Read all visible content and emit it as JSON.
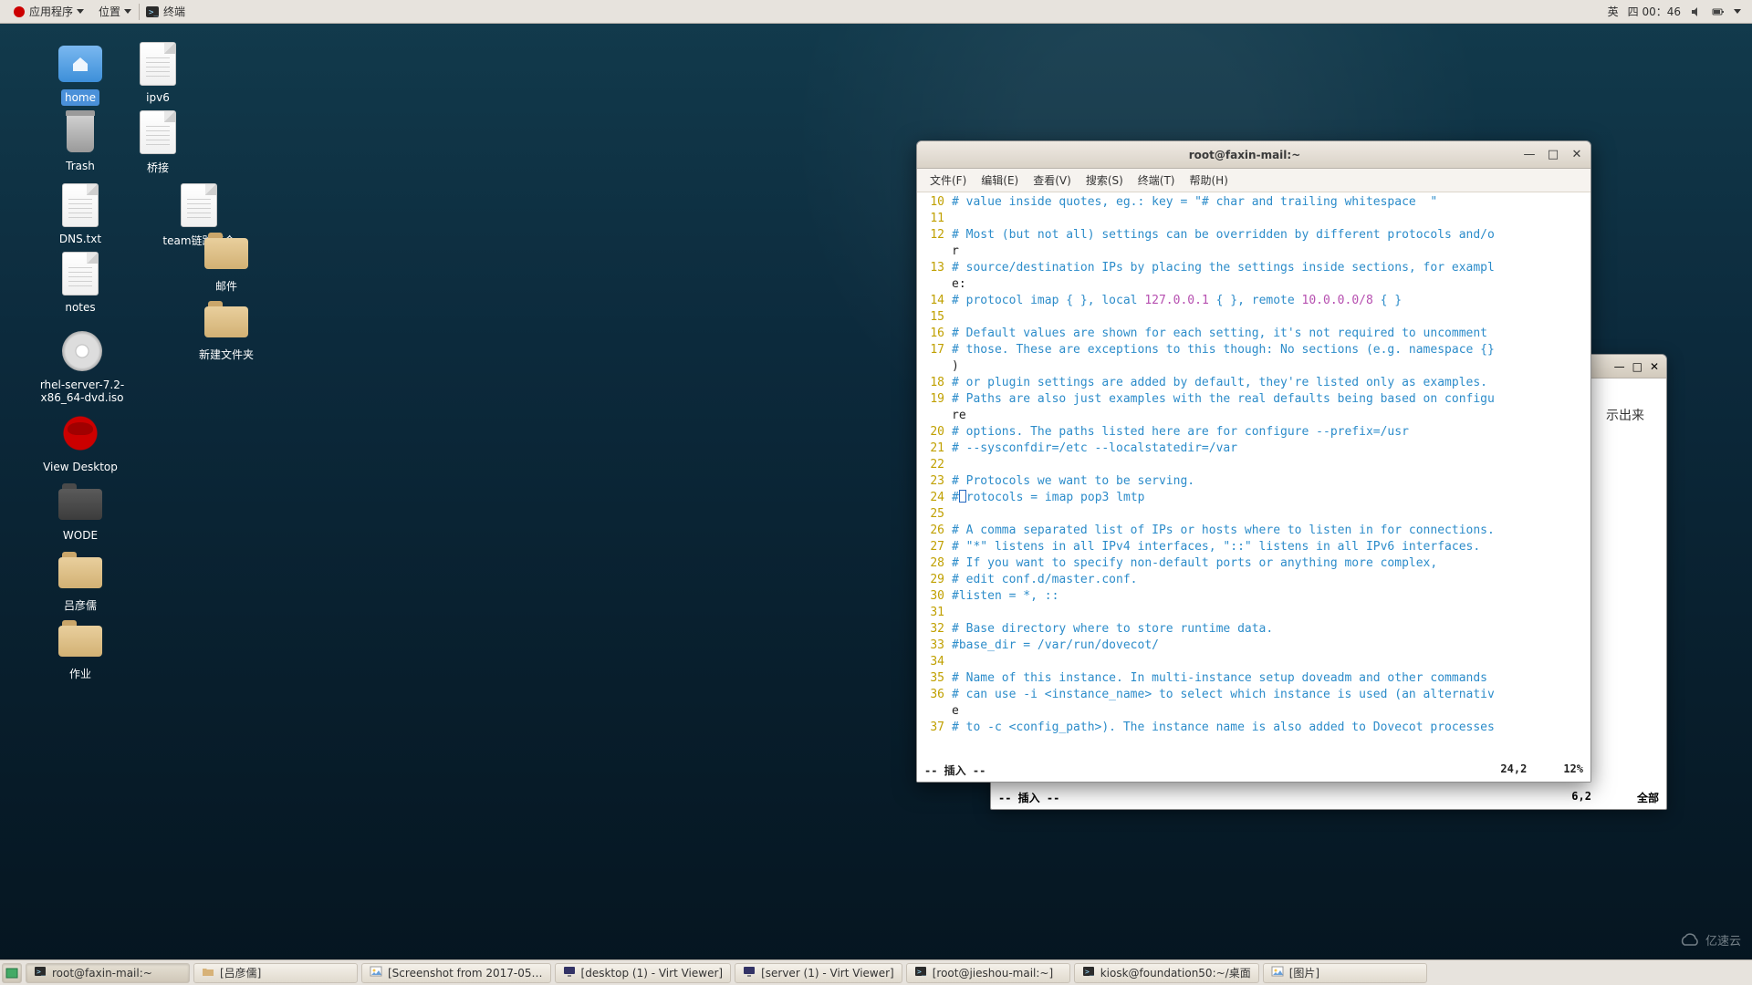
{
  "topbar": {
    "applications": "应用程序",
    "places": "位置",
    "running_app": "终端",
    "input": "英",
    "clock": "四 00：46"
  },
  "desktop_icons": {
    "home": "home",
    "ipv6": "ipv6",
    "trash": "Trash",
    "bridge": "桥接",
    "dns": "DNS.txt",
    "team": "team链路聚合",
    "notes": "notes",
    "mail": "邮件",
    "newfolder": "新建文件夹",
    "iso": "rhel-server-7.2-x86_64-dvd.iso",
    "viewdesktop": "View Desktop",
    "wode": "WODE",
    "lyr": "吕彦儒",
    "homework": "作业"
  },
  "terminal": {
    "title": "root@faxin-mail:~",
    "menu": {
      "file": "文件(F)",
      "edit": "编辑(E)",
      "view": "查看(V)",
      "search": "搜索(S)",
      "terminal": "终端(T)",
      "help": "帮助(H)"
    },
    "lines": [
      {
        "n": "10",
        "t": "# value inside quotes, eg.: key = \"# char and trailing whitespace  \"",
        "c": "cmnt"
      },
      {
        "n": "11",
        "t": "",
        "c": "plain"
      },
      {
        "n": "12",
        "t": "# Most (but not all) settings can be overridden by different protocols and/o",
        "c": "cmnt"
      },
      {
        "n": "",
        "t": "r",
        "c": "plain"
      },
      {
        "n": "13",
        "t": "# source/destination IPs by placing the settings inside sections, for exampl",
        "c": "cmnt"
      },
      {
        "n": "",
        "t": "e:",
        "c": "plain"
      },
      {
        "n": "14",
        "t": "# protocol imap { }, local 127.0.0.1 { }, remote 10.0.0.0/8 { }",
        "c": "cmnt",
        "nums": [
          "127.0.0.1",
          "10.0.0.0/8"
        ]
      },
      {
        "n": "15",
        "t": "",
        "c": "plain"
      },
      {
        "n": "16",
        "t": "# Default values are shown for each setting, it's not required to uncomment",
        "c": "cmnt"
      },
      {
        "n": "17",
        "t": "# those. These are exceptions to this though: No sections (e.g. namespace {}",
        "c": "cmnt"
      },
      {
        "n": "",
        "t": ")",
        "c": "plain"
      },
      {
        "n": "18",
        "t": "# or plugin settings are added by default, they're listed only as examples.",
        "c": "cmnt"
      },
      {
        "n": "19",
        "t": "# Paths are also just examples with the real defaults being based on configu",
        "c": "cmnt"
      },
      {
        "n": "",
        "t": "re",
        "c": "plain"
      },
      {
        "n": "20",
        "t": "# options. The paths listed here are for configure --prefix=/usr",
        "c": "cmnt"
      },
      {
        "n": "21",
        "t": "# --sysconfdir=/etc --localstatedir=/var",
        "c": "cmnt"
      },
      {
        "n": "22",
        "t": "",
        "c": "plain"
      },
      {
        "n": "23",
        "t": "# Protocols we want to be serving.",
        "c": "cmnt"
      },
      {
        "n": "24",
        "t": "#protocols = imap pop3 lmtp",
        "c": "cmnt",
        "cursor": 1
      },
      {
        "n": "25",
        "t": "",
        "c": "plain"
      },
      {
        "n": "26",
        "t": "# A comma separated list of IPs or hosts where to listen in for connections.",
        "c": "cmnt"
      },
      {
        "n": "27",
        "t": "# \"*\" listens in all IPv4 interfaces, \"::\" listens in all IPv6 interfaces.",
        "c": "cmnt"
      },
      {
        "n": "28",
        "t": "# If you want to specify non-default ports or anything more complex,",
        "c": "cmnt"
      },
      {
        "n": "29",
        "t": "# edit conf.d/master.conf.",
        "c": "cmnt"
      },
      {
        "n": "30",
        "t": "#listen = *, ::",
        "c": "cmnt"
      },
      {
        "n": "31",
        "t": "",
        "c": "plain"
      },
      {
        "n": "32",
        "t": "# Base directory where to store runtime data.",
        "c": "cmnt"
      },
      {
        "n": "33",
        "t": "#base_dir = /var/run/dovecot/",
        "c": "cmnt"
      },
      {
        "n": "34",
        "t": "",
        "c": "plain"
      },
      {
        "n": "35",
        "t": "# Name of this instance. In multi-instance setup doveadm and other commands",
        "c": "cmnt"
      },
      {
        "n": "36",
        "t": "# can use -i <instance_name> to select which instance is used (an alternativ",
        "c": "cmnt"
      },
      {
        "n": "",
        "t": "e",
        "c": "plain"
      },
      {
        "n": "37",
        "t": "# to -c <config_path>). The instance name is also added to Dovecot processes",
        "c": "cmnt"
      }
    ],
    "status": {
      "mode": "-- 插入 --",
      "pos": "24,2",
      "pct": "12%"
    }
  },
  "back_terminal": {
    "body_text": "示出来",
    "status": {
      "mode": "-- 插入 --",
      "pos": "6,2",
      "pct": "全部"
    }
  },
  "taskbar": {
    "items": [
      "root@faxin-mail:~",
      "[吕彦儒]",
      "[Screenshot from 2017-05…",
      "[desktop (1) - Virt Viewer]",
      "[server (1) - Virt Viewer]",
      "[root@jieshou-mail:~]",
      "kiosk@foundation50:~/桌面",
      "[图片]"
    ]
  },
  "watermark": "亿速云"
}
